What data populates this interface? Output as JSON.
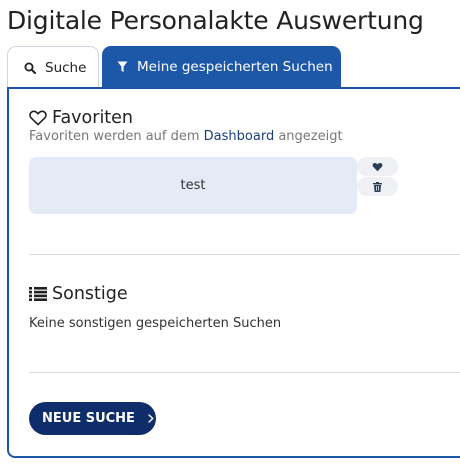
{
  "page": {
    "title": "Digitale Personalakte Auswertung"
  },
  "tabs": {
    "search": {
      "label": "Suche",
      "icon": "search-icon"
    },
    "saved": {
      "label": "Meine gespeicherten Suchen",
      "icon": "filter-icon",
      "active": true
    }
  },
  "favorites": {
    "title": "Favoriten",
    "icon": "heart-outline-icon",
    "hint_before": "Favoriten werden auf dem",
    "hint_link": "Dashboard",
    "hint_after": "angezeigt",
    "items": [
      {
        "label": "test",
        "actions": [
          "heart-icon",
          "trash-icon"
        ]
      }
    ]
  },
  "other": {
    "title": "Sonstige",
    "icon": "list-icon",
    "empty_text": "Keine sonstigen gespeicherten Suchen"
  },
  "new_search_button": {
    "label": "NEUE SUCHE",
    "icon": "chevron-right-icon"
  },
  "colors": {
    "accent": "#1c57a8",
    "button": "#0f2d6b",
    "card": "#e4ebf6",
    "link": "#1a3d7a"
  }
}
